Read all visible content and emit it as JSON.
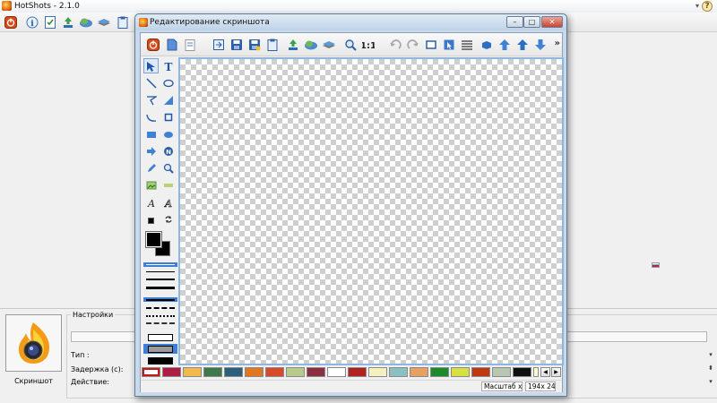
{
  "main_window": {
    "title": "HotShots - 2.1.0",
    "help_icon": "?"
  },
  "main_toolbar": {
    "icons": [
      "power-icon",
      "info-icon",
      "checklist-icon",
      "upload-icon",
      "cloud-icon",
      "stack-icon",
      "clipboard-icon"
    ]
  },
  "bottom_panel": {
    "screenshot_label": "Скриншот",
    "settings_title": "Настройки",
    "type_label": "Тип :",
    "delay_label": "Задержка (с):",
    "action_label": "Действие:"
  },
  "editor": {
    "title": "Редактирование скриншота",
    "toolbar_icons": [
      "power-icon",
      "new-icon",
      "open-icon",
      "import-icon",
      "save-icon",
      "save-as-icon",
      "clipboard-icon",
      "upload-icon",
      "cloud-icon",
      "stack-icon",
      "zoom-icon",
      "fit-icon",
      "undo-icon",
      "redo-icon",
      "crop-icon",
      "select-icon",
      "align-icon",
      "raise-icon",
      "up-icon",
      "top-icon",
      "down-icon"
    ],
    "more": "»",
    "tools": [
      "select-tool",
      "text-tool",
      "line-tool",
      "ellipse-outline-tool",
      "polyline-tool",
      "corner-tool",
      "curve-tool",
      "crop-tool",
      "rect-tool",
      "ellipse-tool",
      "arrow-tool",
      "tag-tool",
      "pen-tool",
      "magnifier-tool",
      "image-tool",
      "highlight-tool",
      "text-a-tool",
      "text-a-outline-tool"
    ],
    "palette": [
      "#ffffff",
      "#b01c44",
      "#f2b84b",
      "#3c7a4b",
      "#2b5f7c",
      "#e0781f",
      "#d84a2a",
      "#b9c98a",
      "#8a3040",
      "#ffffff",
      "#b22020",
      "#f5f0c0",
      "#8ac0c0",
      "#e8a060",
      "#1a8a2a",
      "#d8e040",
      "#c03810",
      "#b8c8b0",
      "#101010",
      "#fff8d0"
    ],
    "status": {
      "zoom": "Масштаб x 1",
      "size": "194x 24"
    }
  }
}
